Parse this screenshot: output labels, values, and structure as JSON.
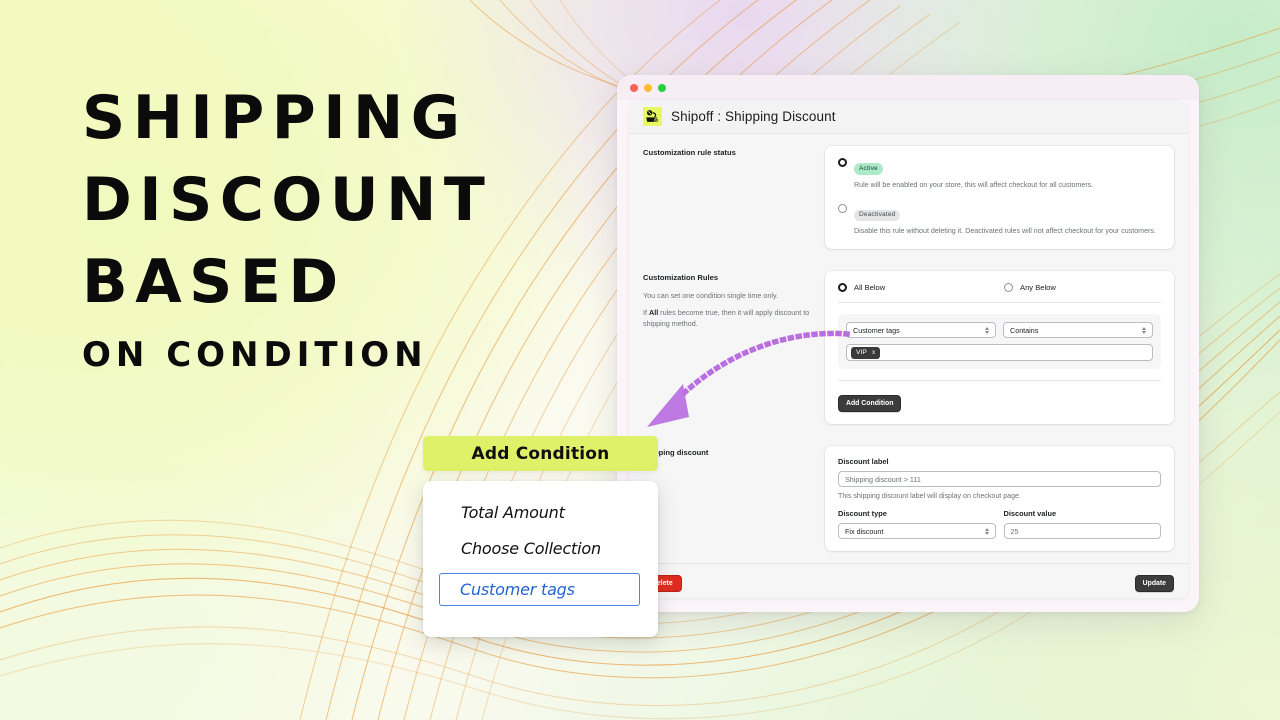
{
  "headline": {
    "line1": "SHIPPING",
    "line2": "DISCOUNT",
    "line3": "BASED",
    "line4": "ON CONDITION"
  },
  "callout": {
    "banner_label": "Add Condition",
    "options": [
      {
        "label": "Total Amount",
        "selected": false
      },
      {
        "label": "Choose Collection",
        "selected": false
      },
      {
        "label": "Customer tags",
        "selected": true
      }
    ]
  },
  "window": {
    "traffic_lights": [
      "#ff6058",
      "#ffbd2e",
      "#2ace42"
    ],
    "app_title": "Shipoff : Shipping Discount",
    "app_logo_icon": "shipping-discount-icon",
    "app_logo_bg": "#e8f863"
  },
  "status_section": {
    "label": "Customization rule status",
    "options": [
      {
        "badge": "Active",
        "badge_color": "#aee9c8",
        "selected": true,
        "description": "Rule will be enabled on your store, this will affect checkout for all customers."
      },
      {
        "badge": "Deactivated",
        "badge_color": "#e4e5e7",
        "selected": false,
        "description": "Disable this rule without deleting it. Deactivated rules will not affect checkout for your customers."
      }
    ]
  },
  "rules_section": {
    "label": "Customization Rules",
    "note1": "You can set one condition single time only.",
    "note2_pre": "If ",
    "note2_bold": "All",
    "note2_post": " rules become true, then it will apply discount to shipping method.",
    "match_options": [
      {
        "label": "All Below",
        "selected": true
      },
      {
        "label": "Any Below",
        "selected": false
      }
    ],
    "condition": {
      "field_value": "Customer tags",
      "operator_value": "Contains",
      "tags": [
        {
          "label": "VIP",
          "remove": "x"
        }
      ]
    },
    "add_condition_label": "Add Condition"
  },
  "discount_section": {
    "label": "shipping discount",
    "discount_label_title": "Discount label",
    "discount_label_value": "Shipping discount > 111",
    "discount_label_help": "This shipping discount label will display on checkout page.",
    "discount_type_title": "Discount type",
    "discount_type_value": "Fix discount",
    "discount_value_title": "Discount value",
    "discount_value_value": "25"
  },
  "footer": {
    "delete_label": "Delete",
    "update_label": "Update"
  },
  "colors": {
    "accent_yellow": "#ddf269",
    "arrow_purple": "#b96fe0",
    "wave_orange": "#e8922f",
    "link_blue": "#2563d6",
    "danger_red": "#e02c20"
  }
}
